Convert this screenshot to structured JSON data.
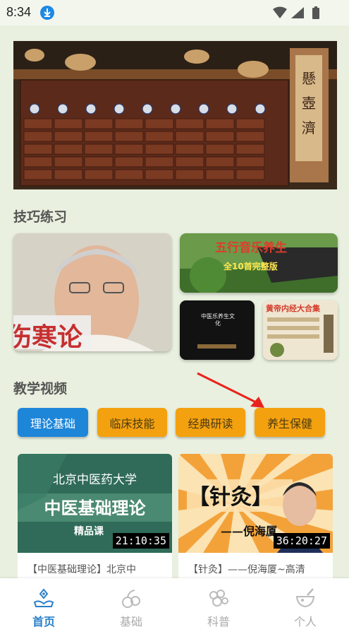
{
  "status": {
    "time": "8:34"
  },
  "sections": {
    "practice_title": "技巧练习",
    "video_title": "教学视频"
  },
  "practice_cards": {
    "big_caption": "伤寒论",
    "music_title": "五行音乐养生",
    "music_subtitle": "全10首完整版",
    "small1_text": "中医乐养生文化",
    "small2_title": "黄帝内经大合集"
  },
  "tabs": [
    {
      "label": "理论基础",
      "active": true
    },
    {
      "label": "临床技能",
      "active": false
    },
    {
      "label": "经典研读",
      "active": false
    },
    {
      "label": "养生保健",
      "active": false
    }
  ],
  "videos": [
    {
      "thumb_line1": "北京中医药大学",
      "thumb_line2": "中医基础理论",
      "thumb_line3": "精品课",
      "duration": "21:10:35",
      "title": "【中医基础理论】北京中"
    },
    {
      "thumb_line1": "【针灸】",
      "thumb_line2": "——倪海厦",
      "duration": "36:20:27",
      "title": "【针灸】——倪海厦~高清"
    }
  ],
  "nav": [
    {
      "label": "首页",
      "icon": "home-heart-icon",
      "active": true
    },
    {
      "label": "基础",
      "icon": "herb-icon",
      "active": false
    },
    {
      "label": "科普",
      "icon": "bubbles-icon",
      "active": false
    },
    {
      "label": "个人",
      "icon": "mortar-icon",
      "active": false
    }
  ],
  "colors": {
    "accent": "#1e86d9",
    "tab_inactive": "#f4a10f",
    "background": "#e9f0df",
    "nav_active": "#2a7fc9"
  }
}
